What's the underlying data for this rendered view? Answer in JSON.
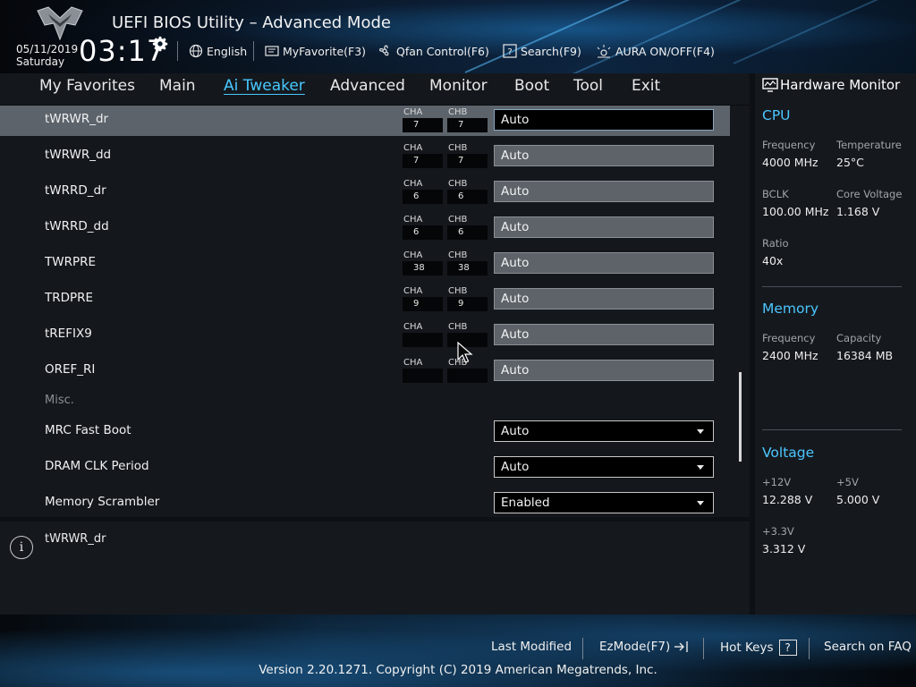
{
  "header": {
    "title": "UEFI BIOS Utility – Advanced Mode",
    "date": "05/11/2019",
    "day": "Saturday",
    "time": "03:17",
    "toolbar": {
      "language": "English",
      "favorite": "MyFavorite(F3)",
      "qfan": "Qfan Control(F6)",
      "search": "Search(F9)",
      "aura": "AURA ON/OFF(F4)"
    }
  },
  "nav": {
    "tabs": [
      "My Favorites",
      "Main",
      "Ai Tweaker",
      "Advanced",
      "Monitor",
      "Boot",
      "Tool",
      "Exit"
    ],
    "active": "Ai Tweaker"
  },
  "main": {
    "cha_label": "CHA",
    "chb_label": "CHB",
    "timings": [
      {
        "label": "tWRWR_dr",
        "cha": "7",
        "chb": "7",
        "value": "Auto",
        "selected": true
      },
      {
        "label": "tWRWR_dd",
        "cha": "7",
        "chb": "7",
        "value": "Auto"
      },
      {
        "label": "tWRRD_dr",
        "cha": "6",
        "chb": "6",
        "value": "Auto"
      },
      {
        "label": "tWRRD_dd",
        "cha": "6",
        "chb": "6",
        "value": "Auto"
      },
      {
        "label": "TWRPRE",
        "cha": "38",
        "chb": "38",
        "value": "Auto"
      },
      {
        "label": "TRDPRE",
        "cha": "9",
        "chb": "9",
        "value": "Auto"
      },
      {
        "label": "tREFIX9",
        "cha": "",
        "chb": "",
        "value": "Auto"
      },
      {
        "label": "OREF_RI",
        "cha": "",
        "chb": "",
        "value": "Auto"
      }
    ],
    "section_misc": "Misc.",
    "dropdowns": [
      {
        "label": "MRC Fast Boot",
        "value": "Auto"
      },
      {
        "label": "DRAM CLK Period",
        "value": "Auto"
      },
      {
        "label": "Memory Scrambler",
        "value": "Enabled"
      }
    ]
  },
  "help": {
    "icon": "info-icon",
    "text": "tWRWR_dr"
  },
  "hardware_monitor": {
    "title": "Hardware Monitor",
    "cpu": {
      "heading": "CPU",
      "frequency_label": "Frequency",
      "frequency": "4000 MHz",
      "temperature_label": "Temperature",
      "temperature": "25°C",
      "bclk_label": "BCLK",
      "bclk": "100.00 MHz",
      "core_voltage_label": "Core Voltage",
      "core_voltage": "1.168 V",
      "ratio_label": "Ratio",
      "ratio": "40x"
    },
    "memory": {
      "heading": "Memory",
      "frequency_label": "Frequency",
      "frequency": "2400 MHz",
      "capacity_label": "Capacity",
      "capacity": "16384 MB"
    },
    "voltage": {
      "heading": "Voltage",
      "v12_label": "+12V",
      "v12": "12.288 V",
      "v5_label": "+5V",
      "v5": "5.000 V",
      "v33_label": "+3.3V",
      "v33": "3.312 V"
    }
  },
  "footer": {
    "last_modified": "Last Modified",
    "ezmode": "EzMode(F7)",
    "hotkeys": "Hot Keys",
    "hotkeys_key": "?",
    "faq": "Search on FAQ",
    "copyright": "Version 2.20.1271. Copyright (C) 2019 American Megatrends, Inc."
  },
  "colors": {
    "accent": "#47c8ff",
    "panel": "#14181d",
    "selected_row": "#5c636b"
  }
}
